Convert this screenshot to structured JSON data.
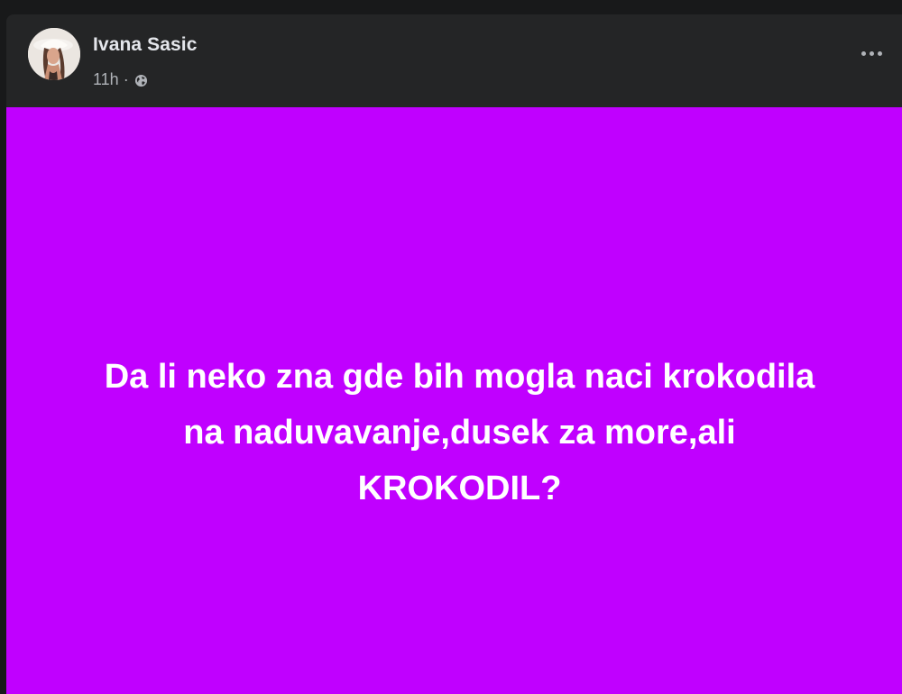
{
  "post": {
    "author": "Ivana Sasic",
    "timestamp": "11h",
    "separator": "·",
    "audience_icon": "globe-icon",
    "more_icon": "more-dots-icon",
    "background_color": "#c000ff",
    "text_lines": [
      "Da li neko zna gde bih mogla naci krokodila",
      "na naduvavanje,dusek za more,ali",
      "KROKODIL?"
    ]
  }
}
